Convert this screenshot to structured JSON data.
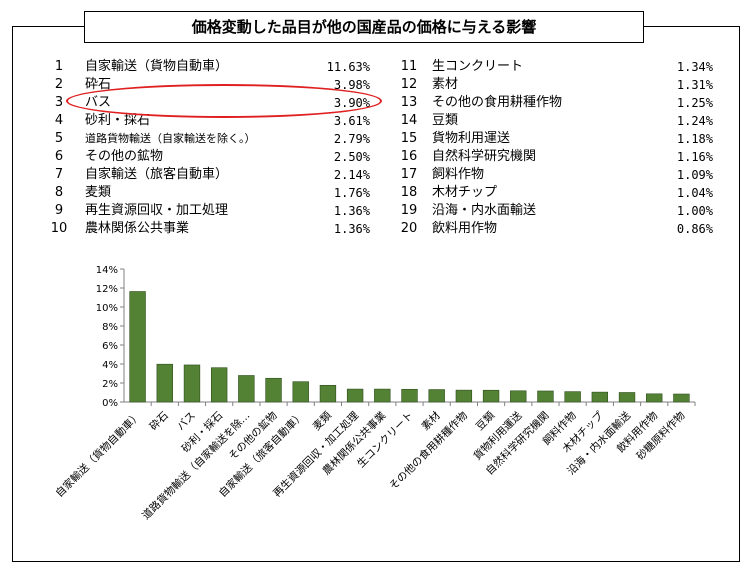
{
  "title": "価格変動した品目が他の国産品の価格に与える影響",
  "ranking": [
    {
      "no": "1",
      "name": "自家輸送（貨物自動車）",
      "value": "11.63%"
    },
    {
      "no": "2",
      "name": "砕石",
      "value": "3.98%"
    },
    {
      "no": "3",
      "name": "バス",
      "value": "3.90%"
    },
    {
      "no": "4",
      "name": "砂利・採石",
      "value": "3.61%"
    },
    {
      "no": "5",
      "name": "道路貨物輸送（自家輸送を除く。）",
      "value": "2.79%"
    },
    {
      "no": "6",
      "name": "その他の鉱物",
      "value": "2.50%"
    },
    {
      "no": "7",
      "name": "自家輸送（旅客自動車）",
      "value": "2.14%"
    },
    {
      "no": "8",
      "name": "麦類",
      "value": "1.76%"
    },
    {
      "no": "9",
      "name": "再生資源回収・加工処理",
      "value": "1.36%"
    },
    {
      "no": "10",
      "name": "農林関係公共事業",
      "value": "1.36%"
    },
    {
      "no": "11",
      "name": "生コンクリート",
      "value": "1.34%"
    },
    {
      "no": "12",
      "name": "素材",
      "value": "1.31%"
    },
    {
      "no": "13",
      "name": "その他の食用耕種作物",
      "value": "1.25%"
    },
    {
      "no": "14",
      "name": "豆類",
      "value": "1.24%"
    },
    {
      "no": "15",
      "name": "貨物利用運送",
      "value": "1.18%"
    },
    {
      "no": "16",
      "name": "自然科学研究機関",
      "value": "1.16%"
    },
    {
      "no": "17",
      "name": "飼料作物",
      "value": "1.09%"
    },
    {
      "no": "18",
      "name": "木材チップ",
      "value": "1.04%"
    },
    {
      "no": "19",
      "name": "沿海・内水面輸送",
      "value": "1.00%"
    },
    {
      "no": "20",
      "name": "飲料用作物",
      "value": "0.86%"
    }
  ],
  "highlighted_item": "バス",
  "colors": {
    "bar": "#548235",
    "bar_edge": "#2e4d1c",
    "highlight": "#e02020",
    "grid": "#d9d9d9"
  },
  "chart_data": {
    "type": "bar",
    "categories": [
      "自家輸送（貨物自動車）",
      "砕石",
      "バス",
      "砂利・採石",
      "道路貨物輸送（自家輸送を除…",
      "その他の鉱物",
      "自家輸送（旅客自動車）",
      "麦類",
      "再生資源回収・加工処理",
      "農林関係公共事業",
      "生コンクリート",
      "素材",
      "その他の食用耕種作物",
      "豆類",
      "貨物利用運送",
      "自然科学研究機関",
      "飼料作物",
      "木材チップ",
      "沿海・内水面輸送",
      "飲料用作物",
      "砂糖原料作物"
    ],
    "values": [
      11.63,
      3.98,
      3.9,
      3.61,
      2.79,
      2.5,
      2.14,
      1.76,
      1.36,
      1.36,
      1.34,
      1.31,
      1.25,
      1.24,
      1.18,
      1.16,
      1.09,
      1.04,
      1.0,
      0.86,
      0.84
    ],
    "yticks": [
      "0%",
      "2%",
      "4%",
      "6%",
      "8%",
      "10%",
      "12%",
      "14%"
    ],
    "ylim": [
      0,
      14
    ],
    "title": "",
    "xlabel": "",
    "ylabel": "",
    "grid": false,
    "legend": "none"
  }
}
